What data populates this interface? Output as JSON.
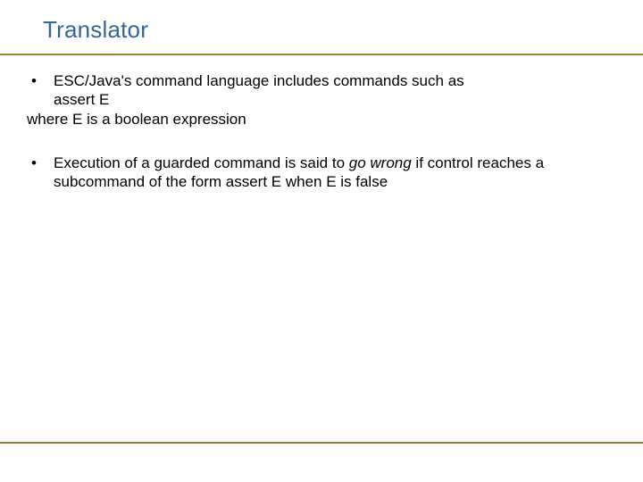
{
  "title": "Translator",
  "block1": {
    "line1": "ESC/Java's command language includes commands such as",
    "line2": "assert E",
    "line3": "where E is a boolean expression"
  },
  "block2": {
    "pre": "Execution of a guarded command is said to ",
    "italic": "go wrong",
    "post": " if control reaches a subcommand of the form assert E when E is false"
  },
  "bullet": "•"
}
